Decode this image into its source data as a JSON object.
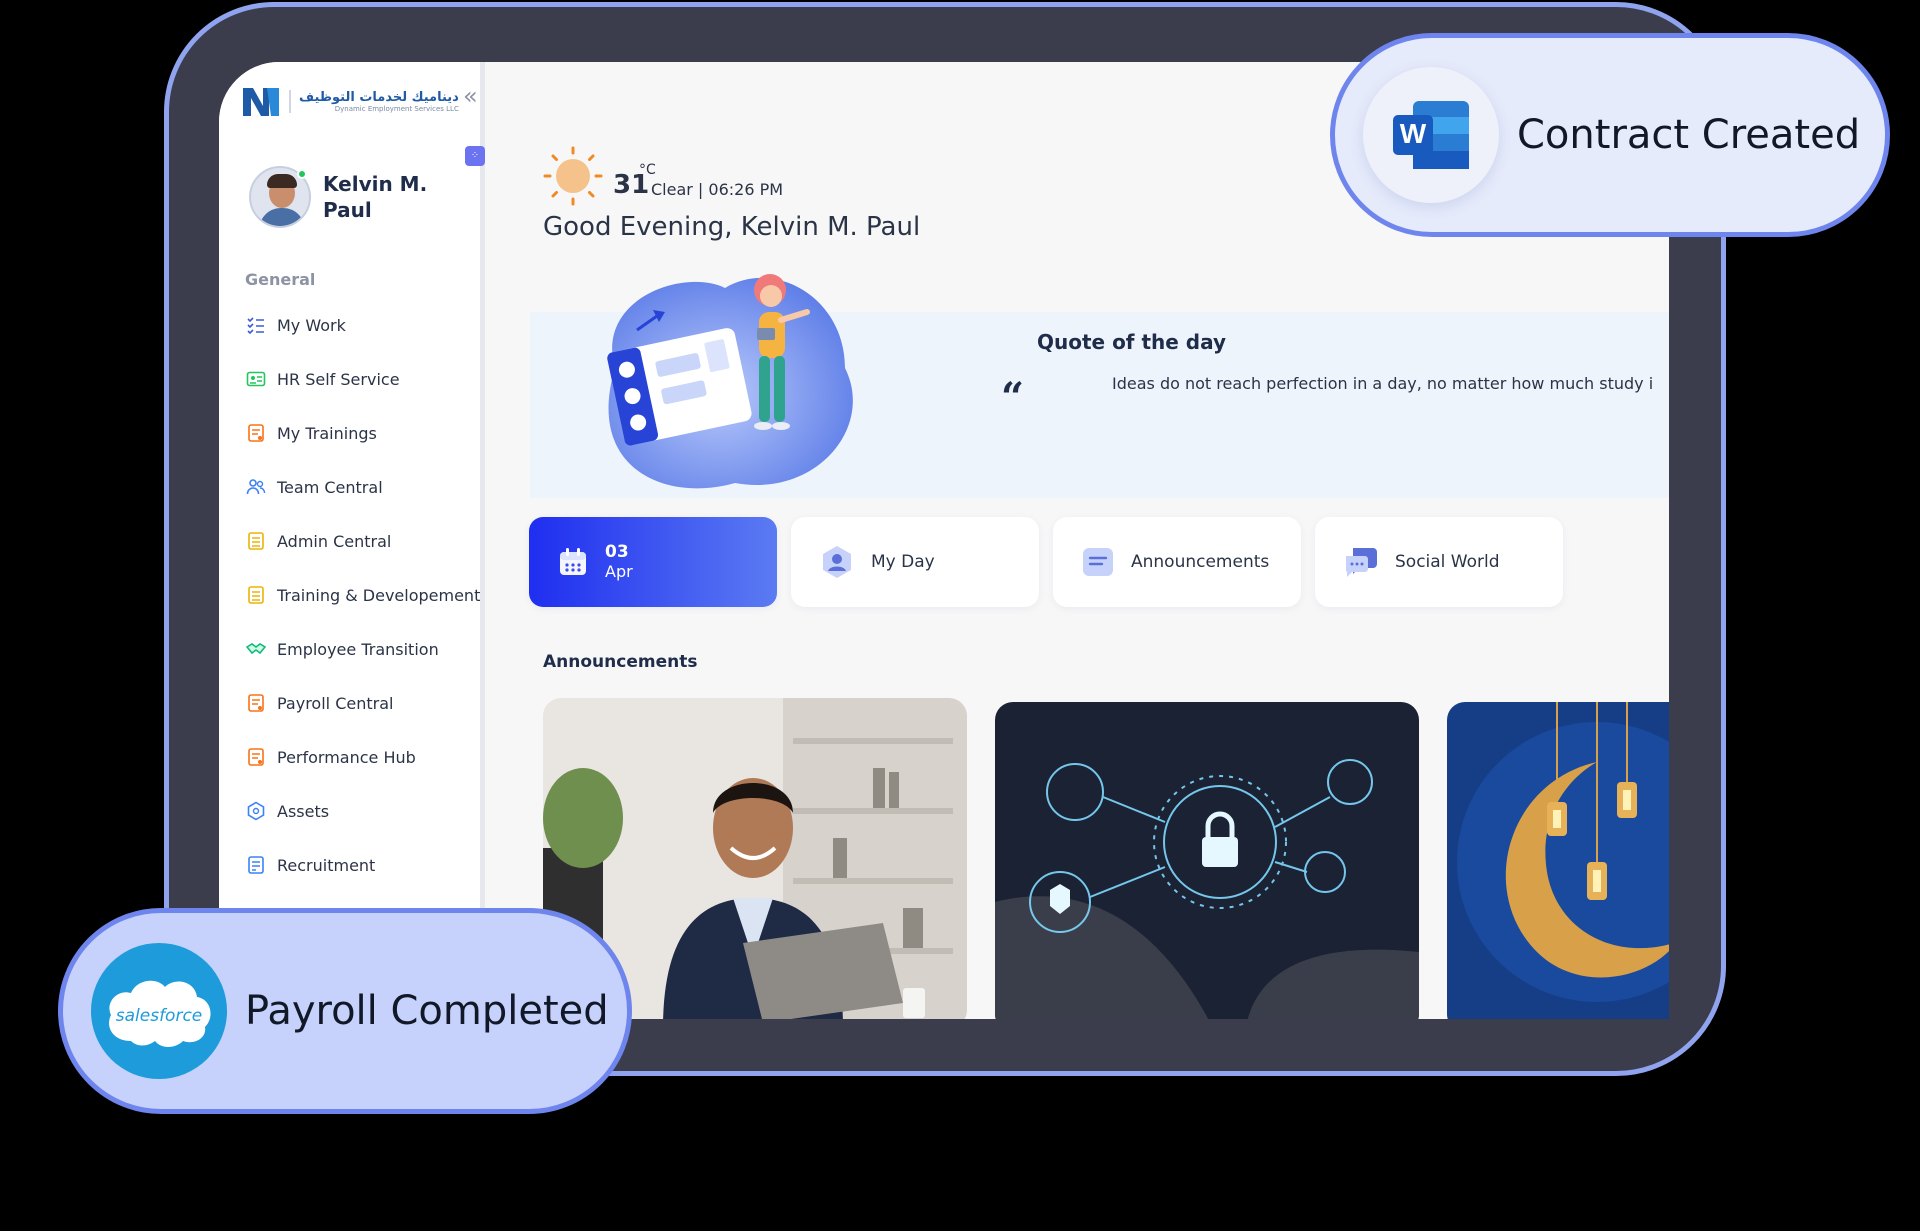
{
  "sidebar": {
    "logo_ar": "ديناميك لخدمات التوظيف",
    "logo_en": "Dynamic Employment Services LLC",
    "collapse_icon": "«",
    "user_name": "Kelvin M. Paul",
    "section_label": "General",
    "items": [
      {
        "label": "My Work",
        "icon": "checklist-icon",
        "color": "#3b5bdb"
      },
      {
        "label": "HR Self Service",
        "icon": "id-card-icon",
        "color": "#22c55e"
      },
      {
        "label": "My Trainings",
        "icon": "document-icon",
        "color": "#f97316"
      },
      {
        "label": "Team Central",
        "icon": "users-icon",
        "color": "#3b82f6"
      },
      {
        "label": "Admin Central",
        "icon": "grid-icon",
        "color": "#eab308"
      },
      {
        "label": "Training & Developement",
        "icon": "grid-icon",
        "color": "#eab308"
      },
      {
        "label": "Employee Transition",
        "icon": "handshake-icon",
        "color": "#10b981"
      },
      {
        "label": "Payroll Central",
        "icon": "document-icon",
        "color": "#f97316"
      },
      {
        "label": "Performance Hub",
        "icon": "document-icon",
        "color": "#f97316"
      },
      {
        "label": "Assets",
        "icon": "hexagon-icon",
        "color": "#3b82f6"
      },
      {
        "label": "Recruitment",
        "icon": "document-icon",
        "color": "#3b82f6"
      }
    ]
  },
  "weather": {
    "temp": "31",
    "unit": "°C",
    "status": "Clear  |  06:26 PM"
  },
  "greeting": "Good Evening, Kelvin M. Paul",
  "quote": {
    "title": "Quote of the day",
    "mark": "“",
    "text": "Ideas do not reach perfection in a day, no matter how much study i"
  },
  "tiles": {
    "date_day": "03",
    "date_month": "Apr",
    "my_day": "My Day",
    "announcements": "Announcements",
    "social_world": "Social World"
  },
  "announcements_heading": "Announcements",
  "notifications": {
    "contract": "Contract Created",
    "payroll": "Payroll Completed",
    "word_letter": "W",
    "salesforce_logo": "salesforce"
  },
  "colors": {
    "frame_border": "#8fa3ef",
    "accent_blue": "#1f2ef0",
    "pill_border": "#6f85ee"
  }
}
